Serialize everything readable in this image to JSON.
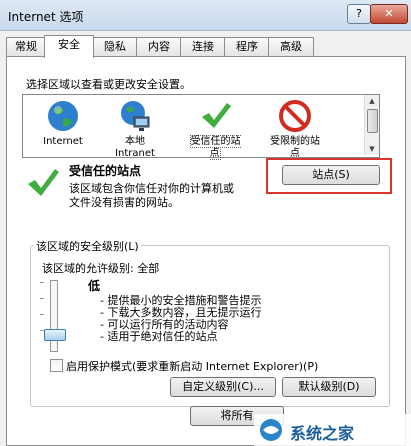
{
  "window": {
    "title": "Internet 选项",
    "help_label": "?",
    "close_label": "✕"
  },
  "tabs": [
    {
      "label": "常规"
    },
    {
      "label": "安全"
    },
    {
      "label": "隐私"
    },
    {
      "label": "内容"
    },
    {
      "label": "连接"
    },
    {
      "label": "程序"
    },
    {
      "label": "高级"
    }
  ],
  "security": {
    "select_zone_text": "选择区域以查看或更改安全设置。",
    "zones": [
      {
        "label": "Internet",
        "icon": "globe-icon"
      },
      {
        "label": "本地\nIntranet",
        "icon": "intranet-icon"
      },
      {
        "label": "受信任的站\n点",
        "icon": "check-icon"
      },
      {
        "label": "受限制的站\n点",
        "icon": "restricted-icon"
      }
    ],
    "selected_zone_title": "受信任的站点",
    "selected_zone_desc_1": "该区域包含你信任对你的计算机或",
    "selected_zone_desc_2": "文件没有损害的网站。",
    "sites_button": "站点(S)",
    "level_group_label": "该区域的安全级别(L)",
    "allowed_levels": "该区域的允许级别: 全部",
    "level_name": "低",
    "level_desc": [
      "- 提供最小的安全措施和警告提示",
      "- 下载大多数内容，且无提示运行",
      "- 可以运行所有的活动内容",
      "- 适用于绝对信任的站点"
    ],
    "protected_mode_label": "启用保护模式(要求重新启动 Internet Explorer)(P)",
    "custom_level_button": "自定义级别(C)...",
    "default_level_button": "默认级别(D)",
    "reset_all_button": "将所有"
  },
  "watermark": {
    "text": "系统之家"
  },
  "colors": {
    "accent_red": "#d9342b"
  }
}
